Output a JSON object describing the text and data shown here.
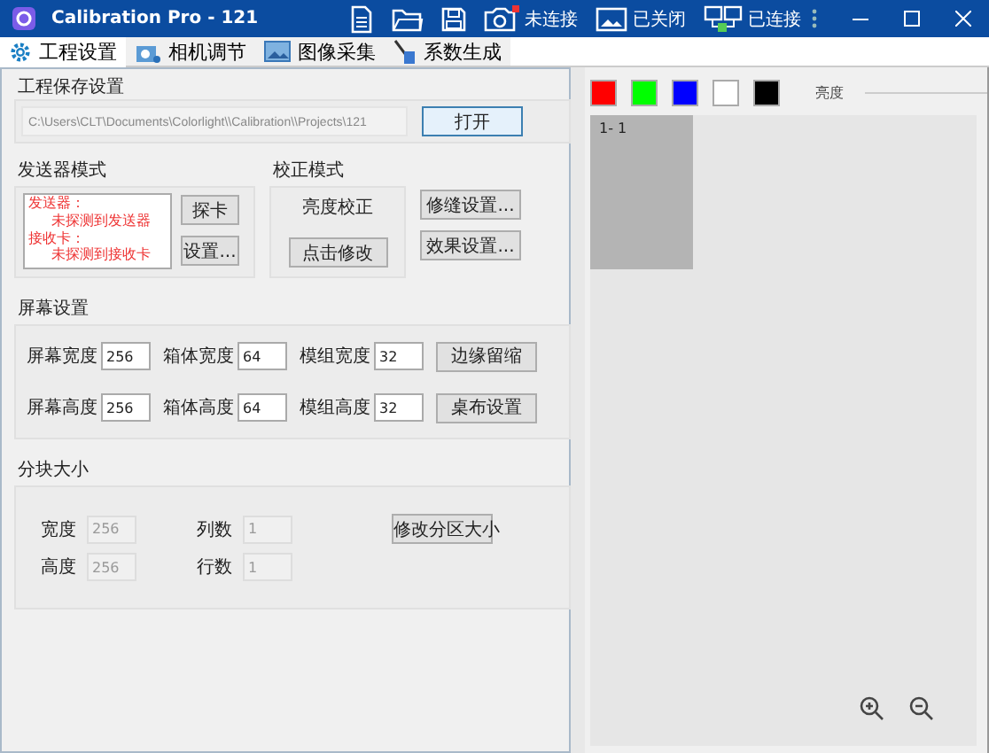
{
  "window": {
    "title": "Calibration Pro - 121"
  },
  "toolbar": [
    {
      "kind": "document"
    },
    {
      "kind": "folder"
    },
    {
      "kind": "save"
    },
    {
      "kind": "camera",
      "label": "未连接"
    },
    {
      "kind": "picture",
      "label": "已关闭"
    },
    {
      "kind": "network",
      "label": "已连接"
    }
  ],
  "tabs": [
    {
      "kind": "gear",
      "label": "工程设置",
      "selected": true
    },
    {
      "kind": "camera",
      "label": "相机调节",
      "selected": false
    },
    {
      "kind": "picture",
      "label": "图像采集",
      "selected": false
    },
    {
      "kind": "pen",
      "label": "系数生成",
      "selected": false
    }
  ],
  "project_save": {
    "title": "工程保存设置",
    "path": "C:\\Users\\CLT\\Documents\\Colorlight\\\\Calibration\\\\Projects\\121",
    "button": "打开"
  },
  "sender_mode": {
    "title": "发送器模式",
    "status_lines": [
      {
        "kind": "heading",
        "text": "发送器："
      },
      {
        "kind": "value",
        "text": "未探测到发送器"
      },
      {
        "kind": "heading",
        "text": "接收卡："
      },
      {
        "kind": "value",
        "text": "未探测到接收卡"
      }
    ],
    "buttons": [
      "探卡",
      "设置..."
    ]
  },
  "correction_mode": {
    "title": "校正模式",
    "mode": "亮度校正",
    "button": "点击修改"
  },
  "side_buttons": [
    "修缝设置...",
    "效果设置..."
  ],
  "screen_settings": {
    "title": "屏幕设置",
    "fields": [
      {
        "label": "屏幕宽度",
        "value": "256"
      },
      {
        "label": "箱体宽度",
        "value": "64"
      },
      {
        "label": "模组宽度",
        "value": "32"
      },
      {
        "label": "屏幕高度",
        "value": "256"
      },
      {
        "label": "箱体高度",
        "value": "64"
      },
      {
        "label": "模组高度",
        "value": "32"
      }
    ],
    "buttons": [
      "边缘留缩",
      "桌布设置"
    ]
  },
  "block_size": {
    "title": "分块大小",
    "fields": [
      {
        "label": "宽度",
        "value": "256",
        "disabled": true
      },
      {
        "label": "列数",
        "value": "1",
        "disabled": true
      },
      {
        "label": "高度",
        "value": "256",
        "disabled": true
      },
      {
        "label": "行数",
        "value": "1",
        "disabled": true
      }
    ],
    "button": "修改分区大小"
  },
  "preview": {
    "swatches": [
      {
        "color": "#ff0000"
      },
      {
        "color": "#00ff00"
      },
      {
        "color": "#0000ff"
      },
      {
        "color": "#ffffff"
      },
      {
        "color": "#000000"
      }
    ],
    "brightness_label": "亮度",
    "tiles": [
      {
        "label": "1- 1"
      }
    ]
  }
}
